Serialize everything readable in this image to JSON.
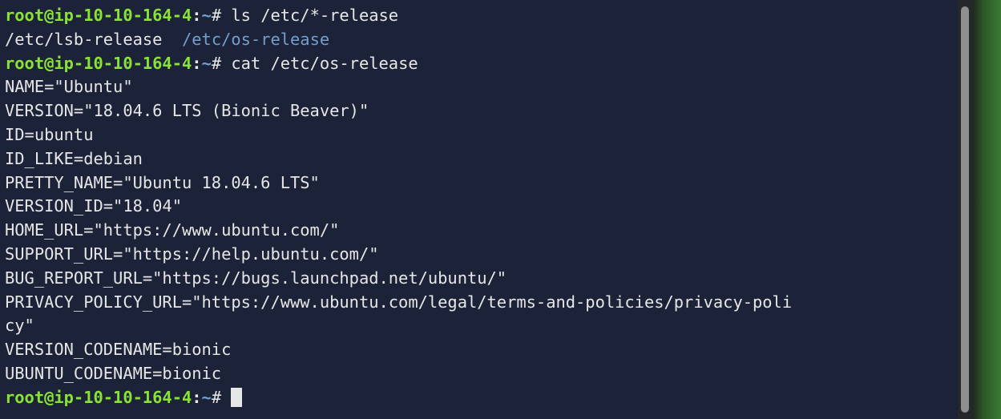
{
  "prompt": {
    "user_host": "root@ip-10-10-164-4",
    "separator": ":",
    "path": "~",
    "symbol": "# "
  },
  "lines": [
    {
      "type": "command",
      "command": "ls /etc/*-release"
    },
    {
      "type": "ls",
      "items": [
        {
          "text": "/etc/lsb-release",
          "kind": "file"
        },
        {
          "text": "/etc/os-release",
          "kind": "link"
        }
      ]
    },
    {
      "type": "command",
      "command": "cat /etc/os-release"
    },
    {
      "type": "output",
      "text": "NAME=\"Ubuntu\""
    },
    {
      "type": "output",
      "text": "VERSION=\"18.04.6 LTS (Bionic Beaver)\""
    },
    {
      "type": "output",
      "text": "ID=ubuntu"
    },
    {
      "type": "output",
      "text": "ID_LIKE=debian"
    },
    {
      "type": "output",
      "text": "PRETTY_NAME=\"Ubuntu 18.04.6 LTS\""
    },
    {
      "type": "output",
      "text": "VERSION_ID=\"18.04\""
    },
    {
      "type": "output",
      "text": "HOME_URL=\"https://www.ubuntu.com/\""
    },
    {
      "type": "output",
      "text": "SUPPORT_URL=\"https://help.ubuntu.com/\""
    },
    {
      "type": "output",
      "text": "BUG_REPORT_URL=\"https://bugs.launchpad.net/ubuntu/\""
    },
    {
      "type": "output",
      "text": "PRIVACY_POLICY_URL=\"https://www.ubuntu.com/legal/terms-and-policies/privacy-poli"
    },
    {
      "type": "output",
      "text": "cy\""
    },
    {
      "type": "output",
      "text": "VERSION_CODENAME=bionic"
    },
    {
      "type": "output",
      "text": "UBUNTU_CODENAME=bionic"
    },
    {
      "type": "command",
      "command": "",
      "cursor": true
    }
  ],
  "colors": {
    "background": "#1c2339",
    "text": "#e6e6e6",
    "prompt_user": "#8ae234",
    "prompt_path": "#729fcf",
    "ls_link": "#729fcf"
  }
}
